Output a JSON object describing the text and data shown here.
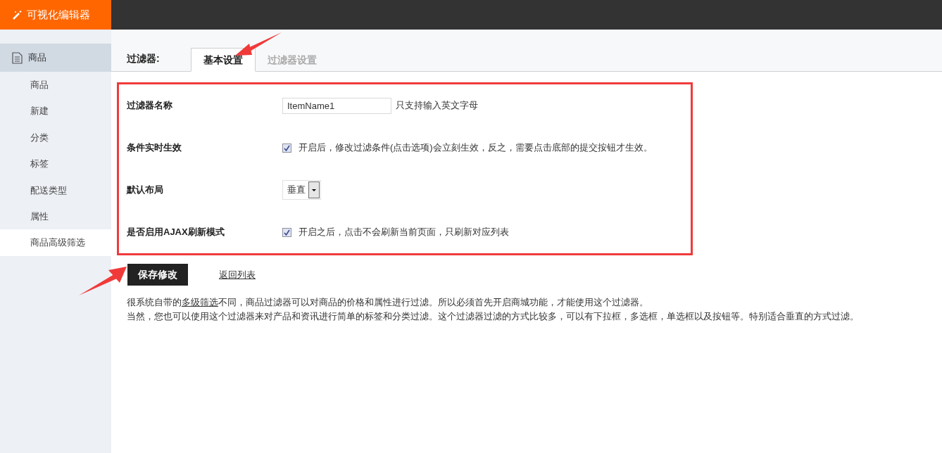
{
  "app": {
    "title": "可视化编辑器"
  },
  "sidebar": {
    "section": "商品",
    "items": [
      {
        "label": "商品",
        "selected": false
      },
      {
        "label": "新建",
        "selected": false
      },
      {
        "label": "分类",
        "selected": false
      },
      {
        "label": "标签",
        "selected": false
      },
      {
        "label": "配送类型",
        "selected": false
      },
      {
        "label": "属性",
        "selected": false
      },
      {
        "label": "商品高级筛选",
        "selected": true
      }
    ]
  },
  "tabs_label": "过滤器:",
  "tabs": [
    {
      "label": "基本设置",
      "selected": true
    },
    {
      "label": "过滤器设置",
      "selected": false
    }
  ],
  "form": [
    {
      "kind": "text",
      "label": "过滤器名称",
      "value": "ItemName1",
      "hint": "只支持输入英文字母"
    },
    {
      "kind": "checkbox",
      "label": "条件实时生效",
      "checked": true,
      "hint": "开启后，修改过滤条件(点击选项)会立刻生效，反之，需要点击底部的提交按钮才生效。"
    },
    {
      "kind": "select",
      "label": "默认布局",
      "value": "垂直"
    },
    {
      "kind": "checkbox",
      "label": "是否启用AJAX刷新模式",
      "checked": true,
      "hint": "开启之后，点击不会刷新当前页面，只刷新对应列表"
    }
  ],
  "save_button": "保存修改",
  "back_link": "返回列表",
  "description": [
    {
      "before": "很系统自带的",
      "link": "多级筛选",
      "after": "不同，商品过滤器可以对商品的价格和属性进行过滤。所以必须首先开启商城功能，才能使用这个过滤器。"
    },
    {
      "before": "当然，您也可以使用这个过滤器来对产品和资讯进行简单的标签和分类过滤。这个过滤器过滤的方式比较多，可以有下拉框，多选框，单选框以及按钮等。特别适合垂直的方式过滤。"
    }
  ]
}
